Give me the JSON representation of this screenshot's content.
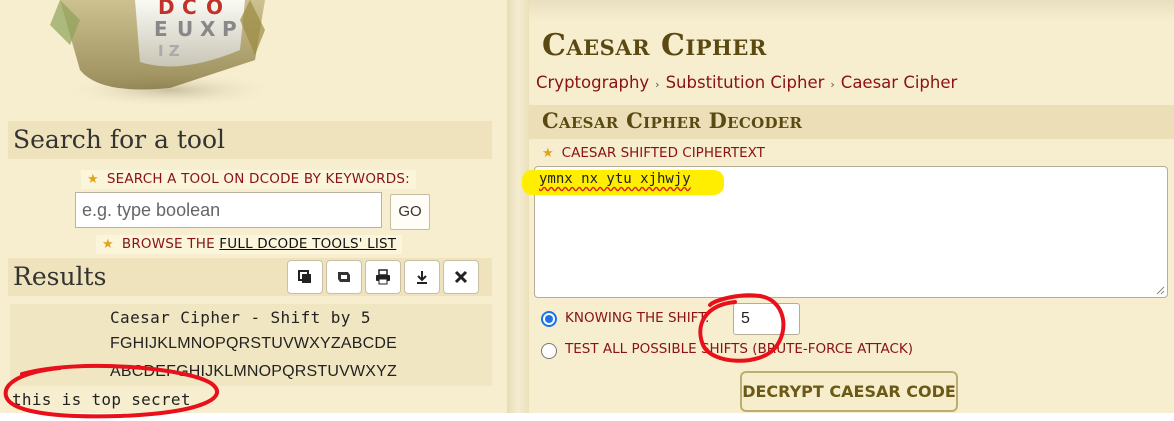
{
  "colors": {
    "panel_bg": "#f7eed0",
    "title_bar_bg": "#ecdfb8",
    "link_red": "#8a1212",
    "heading_brown": "#5a4a12",
    "highlight_yellow": "#ffee00",
    "annotation_red": "#e8101a",
    "radio_blue": "#1a73e8"
  },
  "logo": {
    "icon": "cryptex-logo",
    "letters": "DCODE EUXPL"
  },
  "search": {
    "title": "Search for a tool",
    "tagline": "SEARCH A TOOL ON DCODE BY KEYWORDS:",
    "placeholder": "e.g. type boolean",
    "go_label": "GO",
    "browse_prefix": "BROWSE THE ",
    "browse_link": "FULL DCODE TOOLS' LIST"
  },
  "results": {
    "title": "Results",
    "toolbar_icons": [
      "copy-icon",
      "save-icon",
      "print-icon",
      "download-icon",
      "close-icon"
    ],
    "heading": "Caesar Cipher - Shift by 5",
    "alphabet_shifted": "FGHIJKLMNOPQRSTUVWXYZABCDE",
    "alphabet_plain": "ABCDEFGHIJKLMNOPQRSTUVWXYZ",
    "decoded_text": "this is top secret"
  },
  "page": {
    "title": "Caesar Cipher",
    "breadcrumb": [
      "Cryptography",
      "Substitution Cipher",
      "Caesar Cipher"
    ]
  },
  "decoder": {
    "title": "Caesar Cipher Decoder",
    "ciphertext_label": "CAESAR SHIFTED CIPHERTEXT",
    "ciphertext": "ymnx nx ytu xjhwjy",
    "option_shift_label": "KNOWING THE SHIFT:",
    "shift_value": "5",
    "option_brute_label": "TEST ALL POSSIBLE SHIFTS (BRUTE-FORCE ATTACK)",
    "selected_option": "KNOWING THE SHIFT:",
    "decrypt_label": "DECRYPT CAESAR CODE"
  }
}
